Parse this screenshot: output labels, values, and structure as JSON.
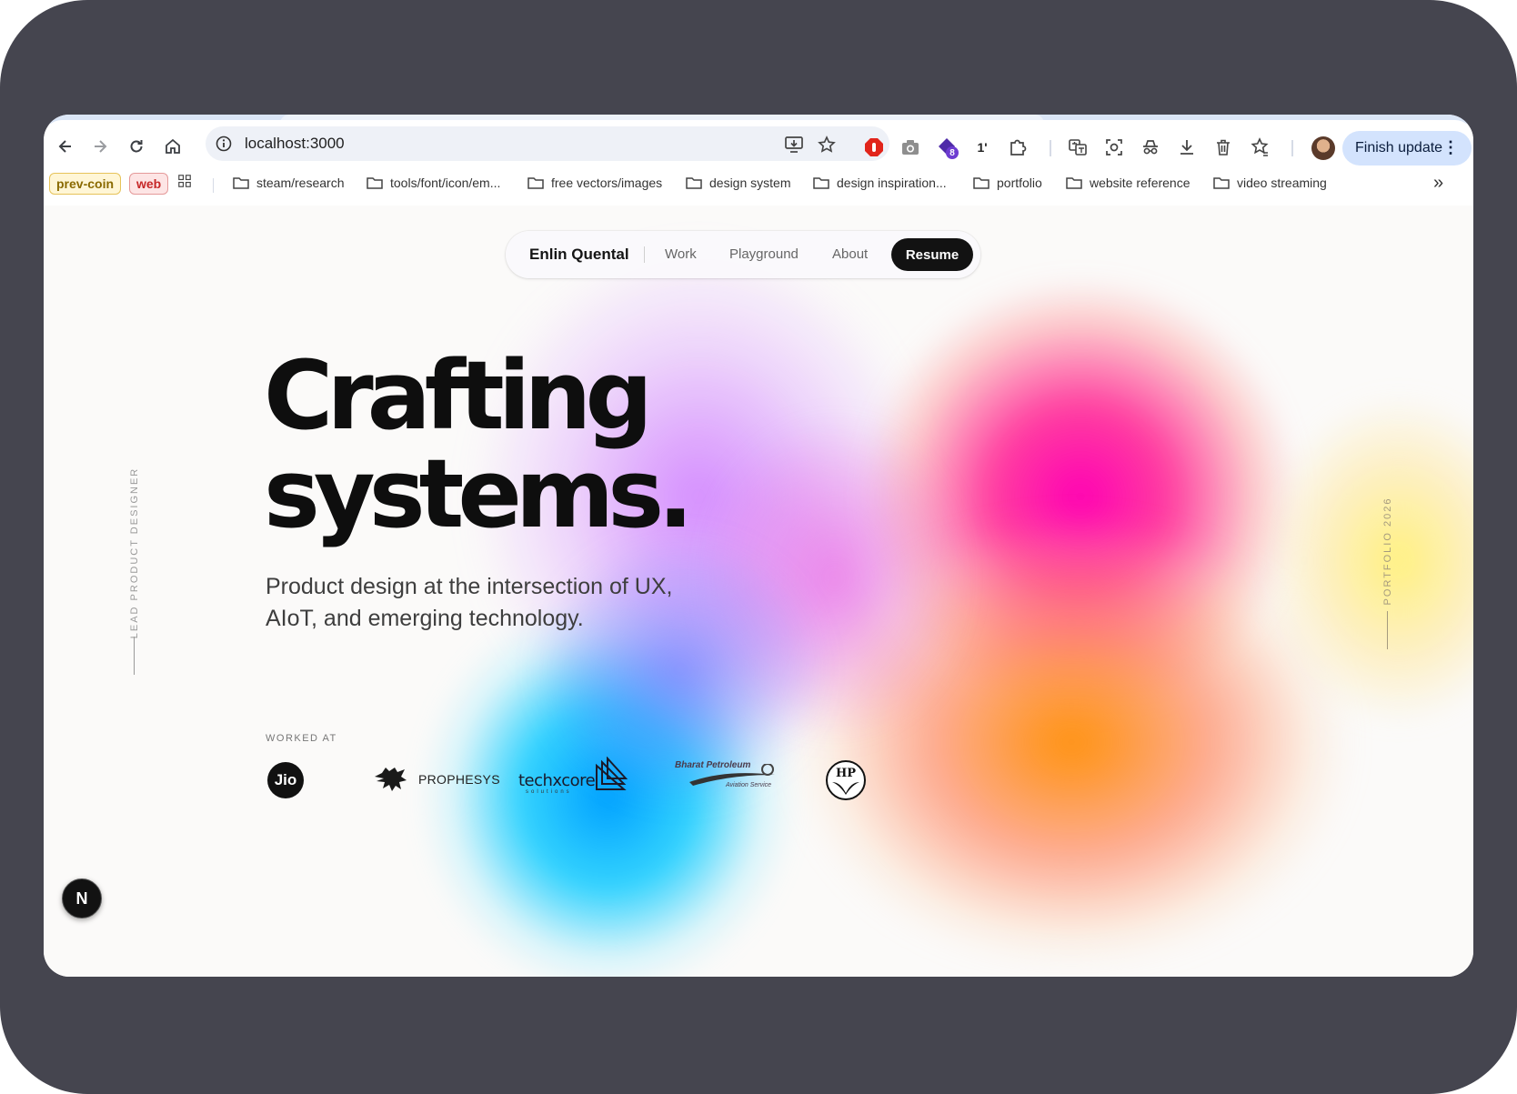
{
  "browser": {
    "url": "localhost:3000",
    "finish_update_label": "Finish update",
    "extension_count_badge": "8",
    "extension_1_text": "1'",
    "bookmarks_chips": [
      {
        "label": "prev-coin",
        "color": "#c79a00",
        "bg": "#fff6d6"
      },
      {
        "label": "web",
        "color": "#c62828",
        "bg": "#fde5e5"
      }
    ],
    "bookmarks": [
      "steam/research",
      "tools/font/icon/em...",
      "free vectors/images",
      "design system",
      "design inspiration...",
      "portfolio",
      "website reference",
      "video streaming"
    ],
    "overflow_label": "»"
  },
  "nav": {
    "brand": "Enlin Quental",
    "links": [
      "Work",
      "Playground",
      "About"
    ],
    "resume": "Resume"
  },
  "hero": {
    "title_line1": "Crafting",
    "title_line2": "systems.",
    "subtitle_line1": "Product design at the intersection of UX,",
    "subtitle_line2": "AIoT, and emerging technology.",
    "side_left": "LEAD PRODUCT DESIGNER",
    "side_right": "PORTFOLIO 2026"
  },
  "worked_at": {
    "heading": "WORKED AT",
    "companies": [
      {
        "name": "Jio"
      },
      {
        "name": "PROPHESYS"
      },
      {
        "name": "techxcore",
        "tagline": "solutions"
      },
      {
        "name": "Bharat Petroleum",
        "tagline": "Aviation Service"
      },
      {
        "name": "HP"
      }
    ]
  },
  "next_badge": "N",
  "colors": {
    "device_bg": "#45454f",
    "accent_pink": "#ff00b4",
    "accent_orange": "#ff9a00",
    "accent_cyan": "#00c8ff",
    "accent_violet": "#b366ff",
    "resume_bg": "#121212",
    "finish_update_bg": "#d3e3fd"
  }
}
